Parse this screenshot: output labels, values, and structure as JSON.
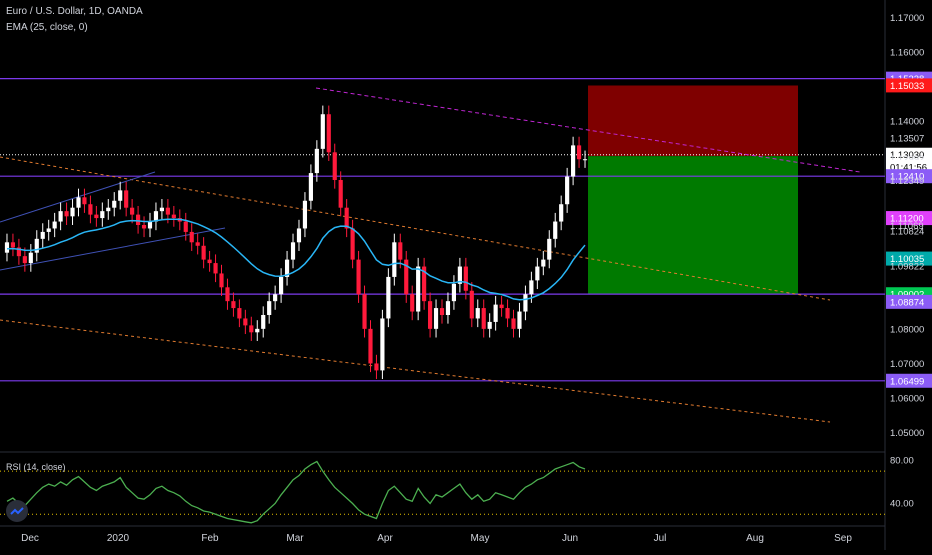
{
  "header": {
    "title": "Euro / U.S. Dollar, 1D, OANDA",
    "indicator": "EMA (25, close, 0)",
    "rsi_label": "RSI (14, close)"
  },
  "colors": {
    "background": "#000000",
    "up": "#ffffff",
    "down": "#ff1a3c",
    "ema": "#29b6f6",
    "rsi": "#4caf50",
    "level_line": "#7c3aed",
    "channel": "#e07a2f",
    "trend": "#c026d3",
    "stop_zone": "#7f0000",
    "target_zone": "#007a00"
  },
  "chart_data": {
    "type": "candlestick",
    "symbol": "EURUSD",
    "timeframe": "1D",
    "ylim": [
      1.045,
      1.175
    ],
    "y_ticks": [
      "1.17000",
      "1.16000",
      "1.15228",
      "1.15033",
      "1.14000",
      "1.13507",
      "1.13030",
      "1.12992",
      "01:41:56",
      "1.12410",
      "1.12349",
      "1.11200",
      "1.11069",
      "1.10824",
      "1.10035",
      "1.09822",
      "1.09002",
      "1.08874",
      "1.08000",
      "1.07000",
      "1.06499",
      "1.06000",
      "1.05000"
    ],
    "x_ticks": [
      "Dec",
      "2020",
      "Feb",
      "Mar",
      "Apr",
      "May",
      "Jun",
      "Jul",
      "Aug",
      "Sep"
    ],
    "candles_close": [
      1.105,
      1.1035,
      1.101,
      1.099,
      1.102,
      1.106,
      1.108,
      1.109,
      1.111,
      1.114,
      1.1125,
      1.115,
      1.118,
      1.116,
      1.113,
      1.112,
      1.114,
      1.115,
      1.117,
      1.12,
      1.115,
      1.113,
      1.11,
      1.109,
      1.111,
      1.114,
      1.115,
      1.113,
      1.112,
      1.111,
      1.108,
      1.105,
      1.104,
      1.1,
      1.099,
      1.096,
      1.092,
      1.088,
      1.086,
      1.083,
      1.081,
      1.079,
      1.08,
      1.084,
      1.088,
      1.09,
      1.095,
      1.1,
      1.105,
      1.109,
      1.117,
      1.125,
      1.132,
      1.142,
      1.131,
      1.123,
      1.115,
      1.109,
      1.1,
      1.09,
      1.08,
      1.07,
      1.068,
      1.083,
      1.095,
      1.105,
      1.1,
      1.09,
      1.085,
      1.098,
      1.088,
      1.08,
      1.086,
      1.084,
      1.088,
      1.093,
      1.098,
      1.091,
      1.083,
      1.086,
      1.08,
      1.082,
      1.087,
      1.086,
      1.083,
      1.08,
      1.085,
      1.09,
      1.094,
      1.098,
      1.1,
      1.106,
      1.111,
      1.116,
      1.124,
      1.133,
      1.129,
      1.129
    ],
    "ema_last": 1.11,
    "levels": [
      1.15228,
      1.1241,
      1.09002,
      1.06499
    ],
    "position": {
      "entry": 1.1299,
      "stop": 1.1503,
      "target": 1.09
    },
    "rsi": {
      "ylim": [
        20,
        85
      ],
      "levels": [
        70,
        30
      ],
      "y_ticks": [
        "80.00",
        "40.00"
      ],
      "values": [
        42,
        45,
        40,
        38,
        44,
        50,
        55,
        58,
        56,
        60,
        57,
        62,
        65,
        60,
        55,
        52,
        56,
        58,
        60,
        64,
        55,
        50,
        45,
        44,
        48,
        54,
        56,
        52,
        50,
        47,
        42,
        38,
        36,
        33,
        32,
        30,
        28,
        26,
        25,
        24,
        23,
        22,
        24,
        30,
        35,
        40,
        48,
        55,
        62,
        66,
        72,
        76,
        79,
        70,
        62,
        55,
        50,
        45,
        40,
        34,
        30,
        28,
        26,
        40,
        52,
        56,
        50,
        44,
        42,
        54,
        46,
        40,
        48,
        46,
        50,
        54,
        58,
        50,
        44,
        48,
        42,
        44,
        50,
        48,
        46,
        44,
        50,
        55,
        58,
        62,
        64,
        68,
        72,
        74,
        76,
        78,
        74,
        72
      ]
    }
  }
}
